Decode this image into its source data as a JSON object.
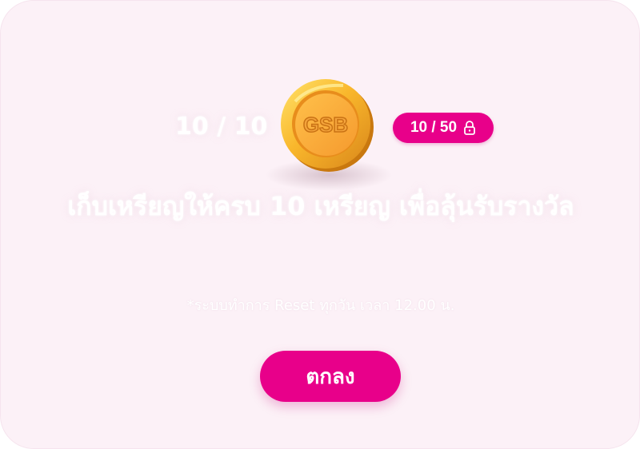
{
  "progress": {
    "current_display": "10 / 10",
    "total_badge": "10 / 50"
  },
  "coin": {
    "label": "GSB",
    "icon": "gsb-coin-icon"
  },
  "message": {
    "headline": "เก็บเหรียญให้ครบ 10 เหรียญ เพื่อลุ้นรับรางวัล",
    "note": "*ระบบทำการ Reset ทุกวัน เวลา 12.00 น."
  },
  "actions": {
    "ok_label": "ตกลง"
  },
  "colors": {
    "accent": "#e8008a",
    "background": "#fcf1f7",
    "coin_gold": "#f7a531"
  }
}
